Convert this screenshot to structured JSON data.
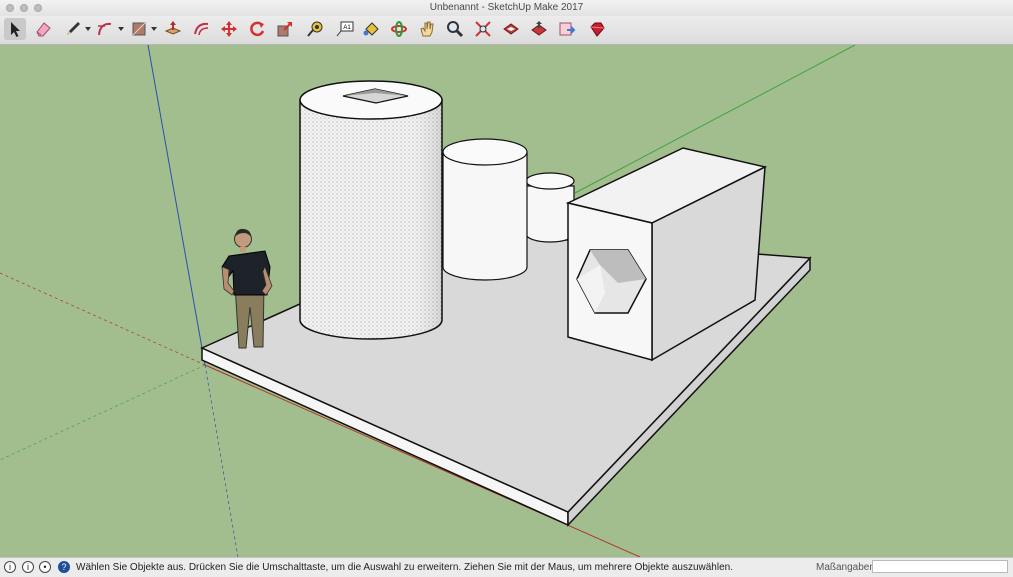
{
  "window": {
    "title": "Unbenannt - SketchUp Make 2017"
  },
  "toolbar": {
    "tools": [
      {
        "name": "select-tool",
        "icon": "arrow-icon"
      },
      {
        "name": "eraser-tool",
        "icon": "eraser-icon"
      },
      {
        "name": "line-tool",
        "icon": "pencil-icon"
      },
      {
        "name": "arc-tool",
        "icon": "arc-icon"
      },
      {
        "name": "shape-tool",
        "icon": "rectangle-icon"
      },
      {
        "name": "push-pull-tool",
        "icon": "push-pull-icon"
      },
      {
        "name": "offset-tool",
        "icon": "offset-icon"
      },
      {
        "name": "move-tool",
        "icon": "move-icon"
      },
      {
        "name": "rotate-tool",
        "icon": "rotate-icon"
      },
      {
        "name": "scale-tool",
        "icon": "scale-icon"
      },
      {
        "name": "tape-measure-tool",
        "icon": "tape-measure-icon"
      },
      {
        "name": "text-tool",
        "icon": "text-icon"
      },
      {
        "name": "paint-bucket-tool",
        "icon": "paint-bucket-icon"
      },
      {
        "name": "orbit-tool",
        "icon": "orbit-icon"
      },
      {
        "name": "pan-tool",
        "icon": "hand-icon"
      },
      {
        "name": "zoom-tool",
        "icon": "magnifier-icon"
      },
      {
        "name": "zoom-extents-tool",
        "icon": "zoom-extents-icon"
      },
      {
        "name": "warehouse-tool",
        "icon": "warehouse-icon"
      },
      {
        "name": "share-model-tool",
        "icon": "share-icon"
      },
      {
        "name": "send-to-layout-tool",
        "icon": "layout-icon"
      },
      {
        "name": "extension-warehouse-tool",
        "icon": "ruby-icon"
      }
    ],
    "text_tool_label": "A1"
  },
  "status": {
    "message": "Wählen Sie Objekte aus. Drücken Sie die Umschalttaste, um die Auswahl zu erweitern. Ziehen Sie mit der Maus, um mehrere Objekte auszuwählen.",
    "measurements_label": "Maßangaben",
    "measurements_value": ""
  },
  "colors": {
    "background_ground": "#a3be8e",
    "face": "#f4f4f4",
    "face_shade": "#dcdcdc",
    "axis_red": "#b0302a",
    "axis_green": "#3fa33f",
    "axis_blue": "#2b4fb0"
  }
}
